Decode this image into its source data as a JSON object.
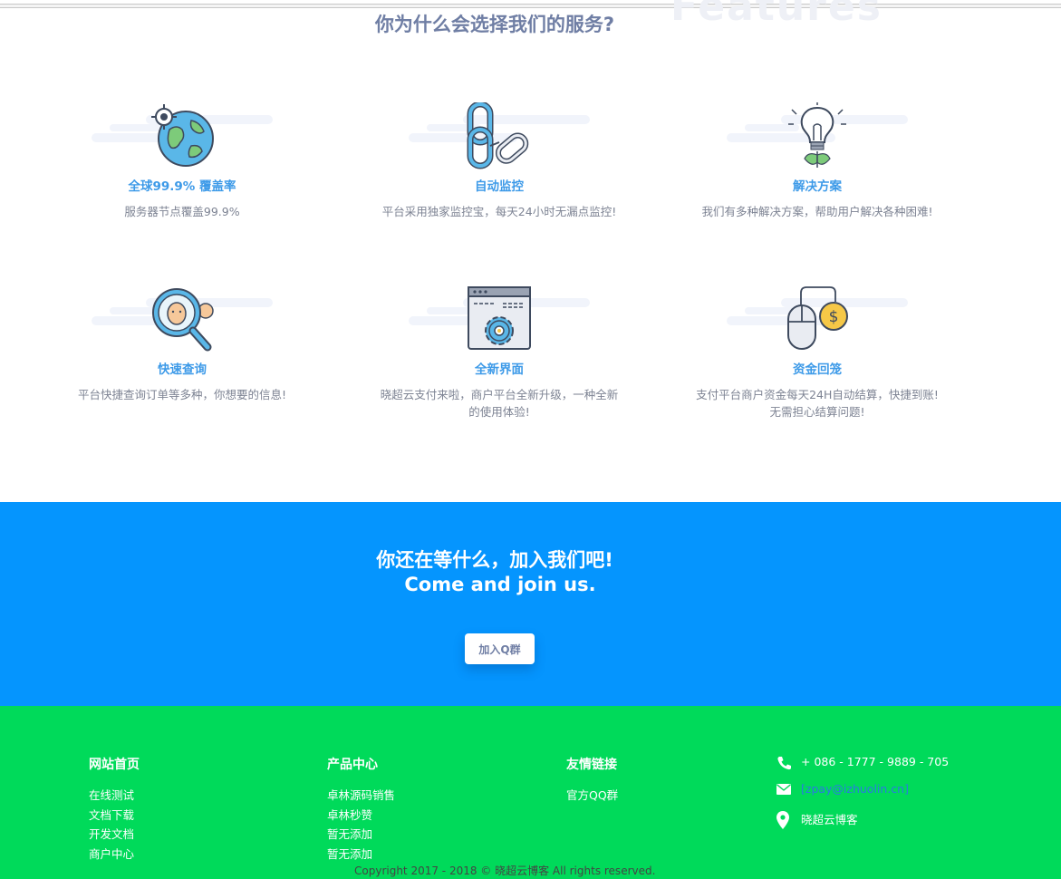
{
  "section": {
    "title": "你为什么会选择我们的服务?"
  },
  "features": [
    {
      "title": "全球99.9% 覆盖率",
      "desc": "服务器节点覆盖99.9%",
      "icon": "globe-icon"
    },
    {
      "title": "自动监控",
      "desc": "平台采用独家监控宝，每天24小时无漏点监控!",
      "icon": "chain-link-icon"
    },
    {
      "title": "解决方案",
      "desc": "我们有多种解决方案，帮助用户解决各种困难!",
      "icon": "lightbulb-icon"
    },
    {
      "title": "快速查询",
      "desc": "平台快捷查询订单等多种，你想要的信息!",
      "icon": "magnifier-icon"
    },
    {
      "title": "全新界面",
      "desc": "晓超云支付来啦，商户平台全新升级，一种全新的使用体验!",
      "icon": "browser-gear-icon"
    },
    {
      "title": "资金回笼",
      "desc": "支付平台商户资金每天24H自动结算，快捷到账!  无需担心结算问题!",
      "icon": "mouse-coin-icon"
    }
  ],
  "join": {
    "title_cn": "你还在等什么，加入我们吧!",
    "title_en": "Come and join us.",
    "button": "加入Q群"
  },
  "footer": {
    "columns": [
      {
        "head": "网站首页",
        "links": [
          "在线测试",
          "文档下载",
          "开发文档",
          "商户中心"
        ]
      },
      {
        "head": "产品中心",
        "links": [
          "卓林源码销售",
          "卓林秒赞",
          "暂无添加",
          "暂无添加"
        ]
      },
      {
        "head": "友情链接",
        "links": [
          "官方QQ群"
        ]
      }
    ],
    "contact": {
      "phone": "+ 086 - 1777 - 9889 - 705",
      "email": "[zpay@izhuolin.cn]",
      "blog": "晓超云博客"
    },
    "copyright": "Copyright 2017 - 2018 © 晓超云博客 All rights reserved."
  },
  "colors": {
    "accent_blue": "#0595fe",
    "footer_green": "#00da5a",
    "title_gray": "#6f7ea4",
    "feature_title": "#3d9ae8"
  }
}
